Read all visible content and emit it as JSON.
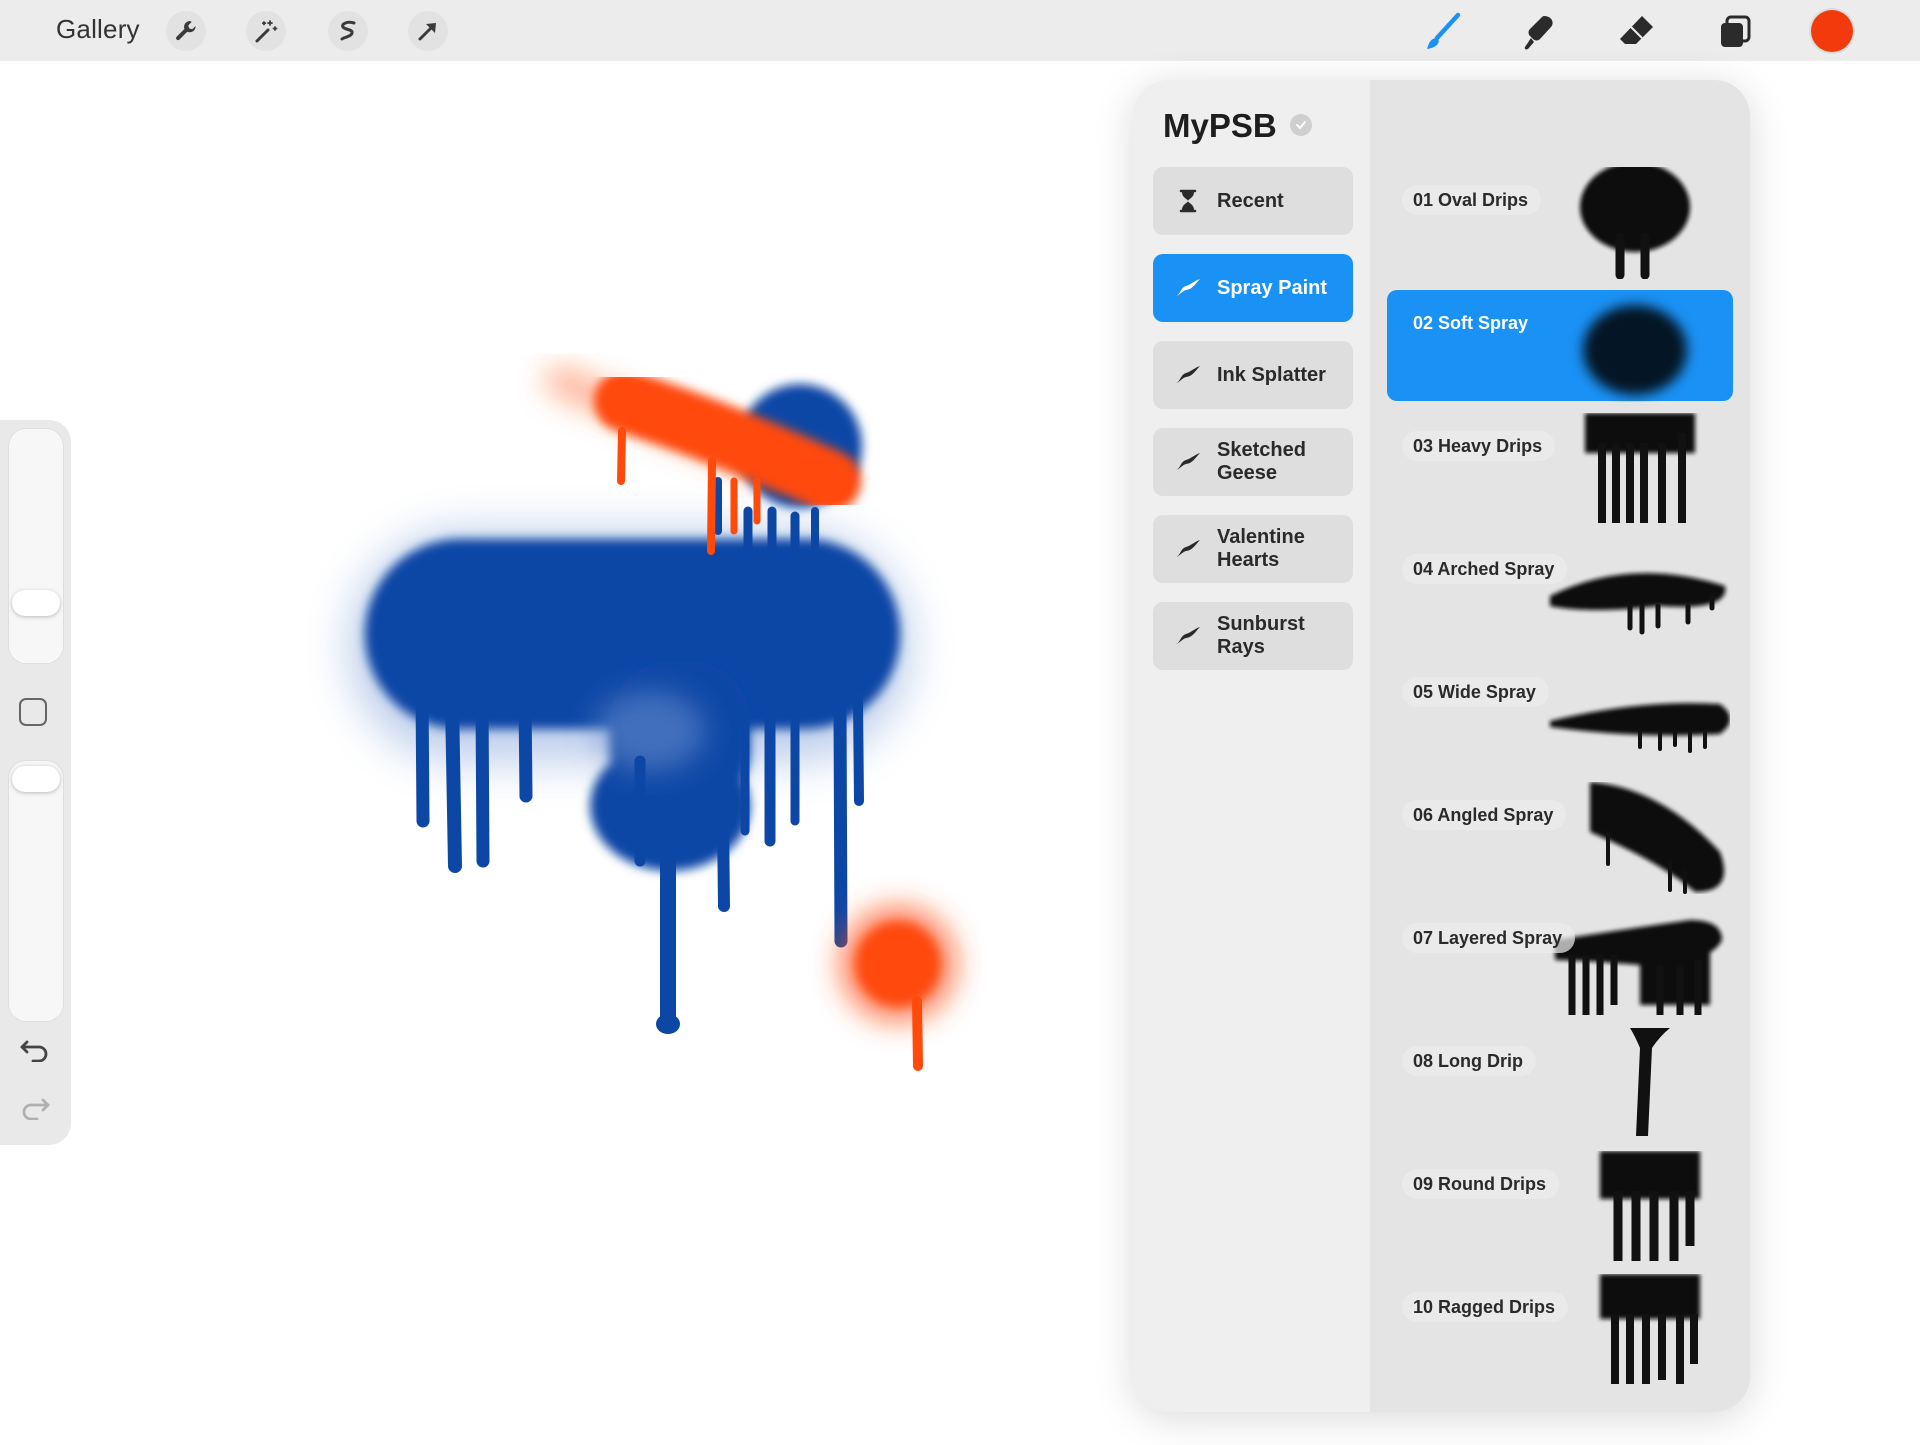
{
  "topbar": {
    "gallery_label": "Gallery",
    "left_tools": [
      "wrench-icon",
      "magic-wand-icon",
      "selection-icon",
      "transform-arrow-icon"
    ],
    "right_tools": [
      "brush-icon",
      "smudge-icon",
      "eraser-icon",
      "layers-icon"
    ],
    "current_color": "#f23a0c"
  },
  "sidebar": {
    "controls": [
      "brush-size-slider",
      "modify-button",
      "opacity-slider",
      "undo-icon",
      "redo-icon"
    ]
  },
  "panel": {
    "title": "MyPSB",
    "add_label": "+",
    "sets": [
      {
        "label": "Recent",
        "icon": "hourglass-icon"
      },
      {
        "label": "Spray Paint",
        "icon": "brush-stroke-icon",
        "active": true
      },
      {
        "label": "Ink Splatter",
        "icon": "brush-stroke-icon"
      },
      {
        "label": "Sketched Geese",
        "icon": "brush-stroke-icon"
      },
      {
        "label": "Valentine Hearts",
        "icon": "brush-stroke-icon"
      },
      {
        "label": "Sunburst Rays",
        "icon": "brush-stroke-icon"
      }
    ],
    "brushes": [
      {
        "label": "01 Oval Drips"
      },
      {
        "label": "02 Soft Spray",
        "active": true
      },
      {
        "label": "03 Heavy Drips"
      },
      {
        "label": "04 Arched Spray"
      },
      {
        "label": "05 Wide Spray"
      },
      {
        "label": "06 Angled Spray"
      },
      {
        "label": "07 Layered Spray"
      },
      {
        "label": "08 Long Drip"
      },
      {
        "label": "09 Round Drips"
      },
      {
        "label": "10 Ragged Drips"
      }
    ]
  },
  "colors": {
    "accent_blue": "#1a91f5",
    "paint_orange": "#ff4a0a",
    "paint_blue": "#0d47a6"
  }
}
